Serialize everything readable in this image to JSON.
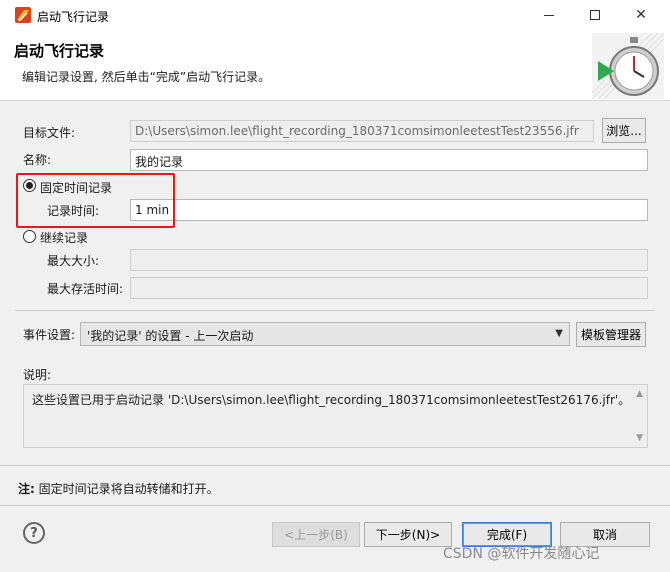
{
  "window": {
    "title": "启动飞行记录"
  },
  "banner": {
    "title": "启动飞行记录",
    "subtitle": "编辑记录设置, 然后单击“完成”启动飞行记录。"
  },
  "form": {
    "target_file_label": "目标文件:",
    "target_file_value": "D:\\Users\\simon.lee\\flight_recording_180371comsimonleetestTest23556.jfr",
    "browse_button": "浏览...",
    "name_label": "名称:",
    "name_value": "我的记录",
    "fixed_time_radio": "固定时间记录",
    "record_time_label": "记录时间:",
    "record_time_value": "1 min",
    "continuous_radio": "继续记录",
    "max_size_label": "最大大小:",
    "max_age_label": "最大存活时间:",
    "event_settings_label": "事件设置:",
    "event_settings_value": "'我的记录' 的设置 - 上一次启动",
    "template_manager_button": "模板管理器",
    "description_label": "说明:",
    "description_value": "这些设置已用于启动记录 'D:\\Users\\simon.lee\\flight_recording_180371comsimonleetestTest26176.jfr'。"
  },
  "note": {
    "prefix": "注:",
    "text": " 固定时间记录将自动转储和打开。"
  },
  "footer": {
    "back_button": "<上一步(B)",
    "next_button": "下一步(N)>",
    "finish_button": "完成(F)",
    "cancel_button": "取消"
  },
  "watermark": "CSDN @软件开发随心记",
  "colors": {
    "highlight_border": "#e31b1b",
    "primary_button_border": "#3c7fd4"
  }
}
